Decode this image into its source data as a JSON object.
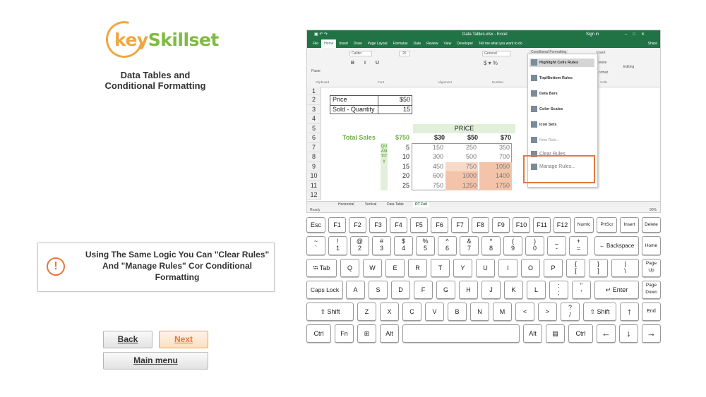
{
  "brand": {
    "key": "key",
    "skillset": "Skillset"
  },
  "title": "Data Tables and Conditional Formatting",
  "info": {
    "icon": "!",
    "message": "Using The Same Logic You Can \"Clear Rules\" And \"Manage Rules\" Cor Conditional Formatting"
  },
  "buttons": {
    "back": "Back",
    "next": "Next",
    "main": "Main menu"
  },
  "excel": {
    "titlebar": "Data Tables.xlsx - Excel",
    "signin": "Sign in",
    "share": "Share",
    "tabs": [
      "File",
      "Home",
      "Insert",
      "Draw",
      "Page Layout",
      "Formulas",
      "Data",
      "Review",
      "View",
      "Developer",
      "Tell me what you want to do"
    ],
    "ribbon": {
      "paste": "Paste",
      "font": "Calibri",
      "size": "26",
      "general": "General",
      "cf": "Conditional Formatting",
      "insert": "Insert",
      "delete": "Delete",
      "format": "Format",
      "editing": "Editing",
      "clipboard": "Clipboard",
      "fontgrp": "Font",
      "alignment": "Alignment",
      "number": "Number",
      "cells": "Cells"
    },
    "rows": [
      "1",
      "2",
      "3",
      "4",
      "5",
      "6",
      "7",
      "8",
      "9",
      "10",
      "11",
      "12"
    ],
    "cells": {
      "price_label": "Price",
      "price_val": "$50",
      "sold_label": "Sold - Quantity",
      "sold_val": "15",
      "price_hdr": "PRICE",
      "total_label": "Total Sales",
      "total_val": "$750",
      "p1": "$30",
      "p2": "$50",
      "p3": "$70",
      "quantity": "QUANTITY",
      "q": [
        "5",
        "10",
        "15",
        "20",
        "25"
      ],
      "c1": [
        "150",
        "300",
        "450",
        "600",
        "750"
      ],
      "c2": [
        "250",
        "500",
        "750",
        "1000",
        "1250"
      ],
      "c3": [
        "350",
        "700",
        "1050",
        "1400",
        "1750"
      ]
    },
    "menu": [
      "Highlight Cells Rules",
      "Top/Bottom Rules",
      "Data Bars",
      "Color Scales",
      "Icon Sets",
      "New Rule...",
      "Clear Rules",
      "Manage Rules..."
    ],
    "sheets": [
      "Horizontal",
      "Vertical",
      "Data Table",
      "DT Full"
    ],
    "status": "Ready",
    "zoom": "90%"
  },
  "keyboard": {
    "row1": [
      "Esc",
      "F1",
      "F2",
      "F3",
      "F4",
      "F5",
      "F6",
      "F7",
      "F8",
      "F9",
      "F10",
      "F11",
      "F12",
      "Numlc",
      "PrtScr",
      "Insert",
      "Delete"
    ],
    "row2": [
      [
        "~",
        "`"
      ],
      [
        "!",
        "1"
      ],
      [
        "@",
        "2"
      ],
      [
        "#",
        "3"
      ],
      [
        "$",
        "4"
      ],
      [
        "%",
        "5"
      ],
      [
        "^",
        "6"
      ],
      [
        "&",
        "7"
      ],
      [
        "*",
        "8"
      ],
      [
        "(",
        "9"
      ],
      [
        ")",
        "0"
      ],
      [
        "_",
        "-"
      ],
      [
        "+",
        "="
      ]
    ],
    "backspace": "Backspace",
    "home": "Home",
    "tab": "Tab",
    "row3": [
      "Q",
      "W",
      "E",
      "R",
      "T",
      "Y",
      "U",
      "I",
      "O",
      "P"
    ],
    "row3b": [
      [
        "{",
        "["
      ],
      [
        "}",
        "]"
      ],
      [
        "|",
        "\\"
      ]
    ],
    "pageup": "Page Up",
    "caps": "Caps Lock",
    "row4": [
      "A",
      "S",
      "D",
      "F",
      "G",
      "H",
      "J",
      "K",
      "L"
    ],
    "row4b": [
      [
        ":",
        ";"
      ],
      [
        "\"",
        "'"
      ]
    ],
    "enter": "Enter",
    "pagedown": "Page Down",
    "shift": "Shift",
    "row5": [
      "Z",
      "X",
      "C",
      "V",
      "B",
      "N",
      "M",
      "<",
      ">"
    ],
    "slash": [
      "?",
      "/"
    ],
    "up": "↑",
    "end": "End",
    "ctrl": "Ctrl",
    "fn": "Fn",
    "alt": "Alt",
    "left": "←",
    "down": "↓",
    "right": "→"
  }
}
